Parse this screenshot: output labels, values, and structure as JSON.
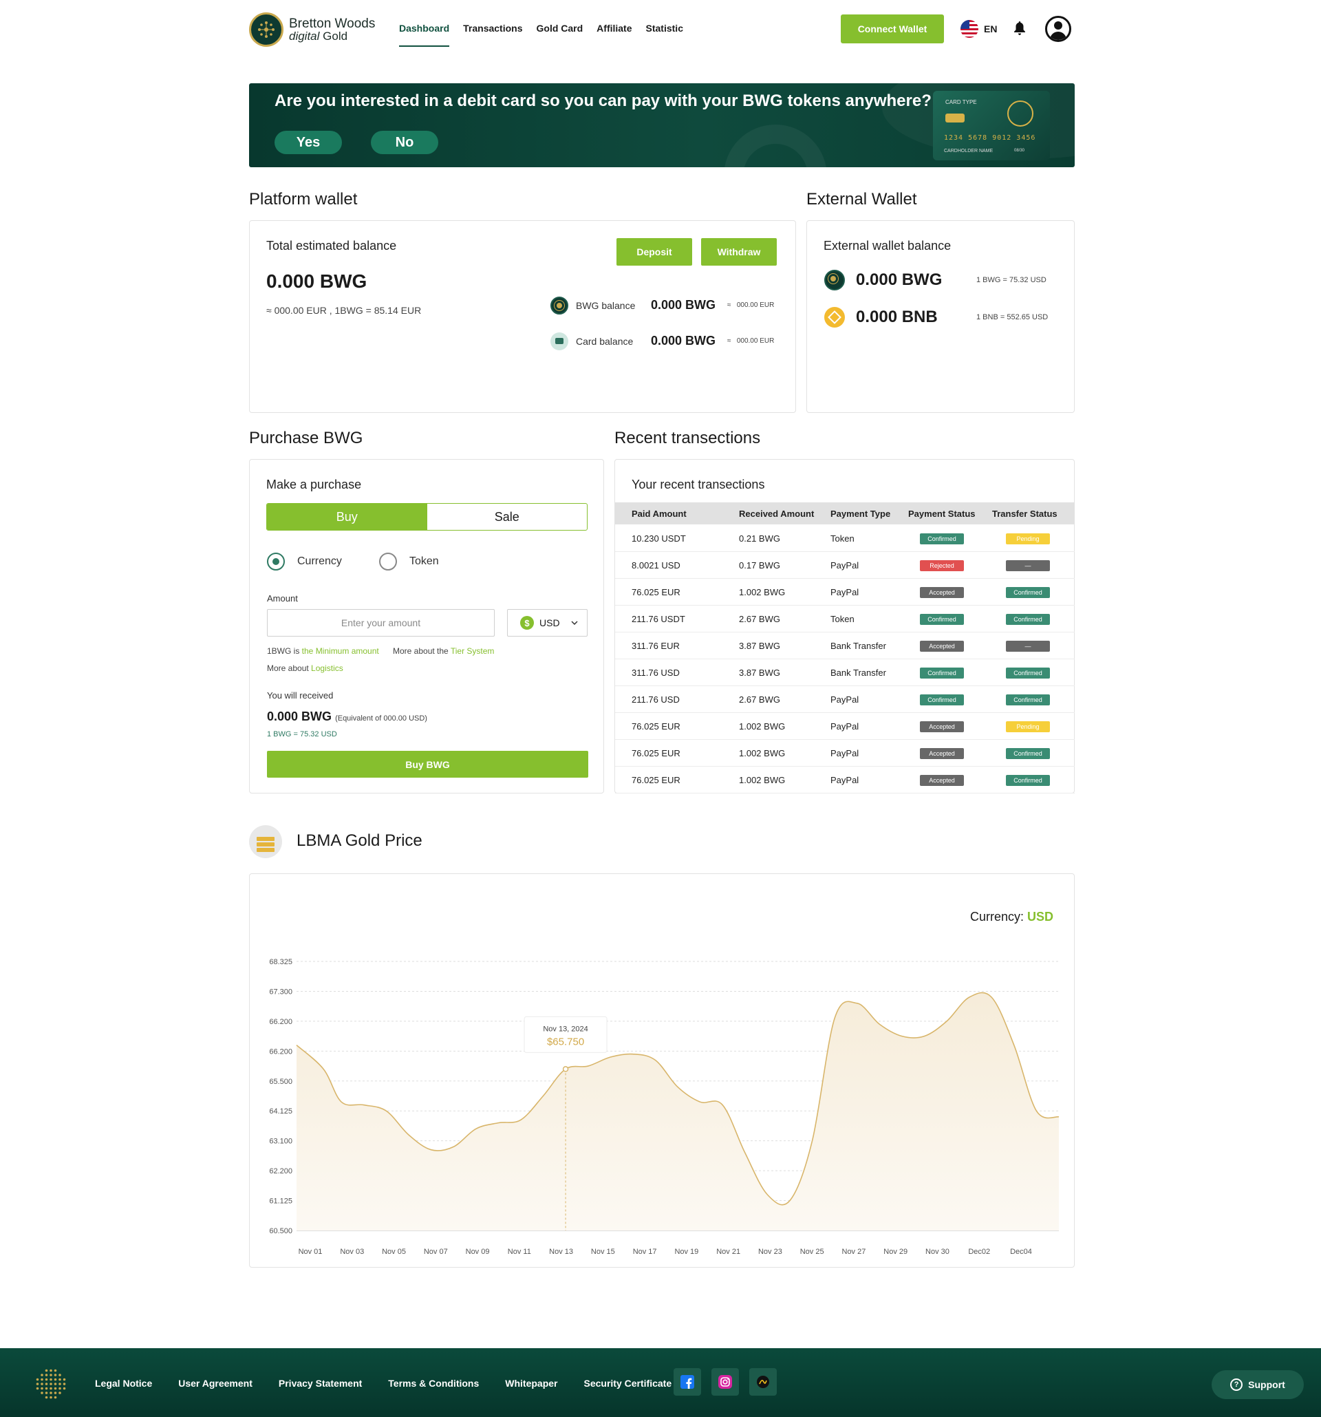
{
  "nav": {
    "logo_line1": "Bretton Woods",
    "logo_line2_italic": "digital",
    "logo_line2": "Gold",
    "menu": [
      "Dashboard",
      "Transactions",
      "Gold Card",
      "Affiliate",
      "Statistic"
    ],
    "active": "Dashboard",
    "connect_wallet": "Connect Wallet",
    "language": "EN"
  },
  "banner": {
    "question": "Are you interested in a debit card so you can pay with your BWG tokens anywhere?",
    "yes": "Yes",
    "no": "No",
    "card_type": "CARD TYPE",
    "card_number": "1234  5678  9012  3456",
    "card_holder": "CARDHOLDER NAME",
    "card_expiry": "08/30"
  },
  "platform_wallet": {
    "title": "Platform wallet",
    "label": "Total estimated balance",
    "deposit": "Deposit",
    "withdraw": "Withdraw",
    "total": "0.000 BWG",
    "approx": "000.00 EUR , 1BWG = 85.14 EUR",
    "bwg_label": "BWG balance",
    "bwg_value": "0.000 BWG",
    "bwg_eur": "000.00 EUR",
    "card_label": "Card balance",
    "card_value": "0.000 BWG",
    "card_eur": "000.00 EUR"
  },
  "external_wallet": {
    "title": "External Wallet",
    "label": "External wallet balance",
    "bwg_value": "0.000 BWG",
    "bwg_rate": "1 BWG  = 75.32 USD",
    "bnb_value": "0.000 BNB",
    "bnb_rate": "1 BNB  = 552.65 USD"
  },
  "purchase": {
    "title": "Purchase BWG",
    "label": "Make a purchase",
    "buy": "Buy",
    "sale": "Sale",
    "currency": "Currency",
    "token": "Token",
    "amount_label": "Amount",
    "amount_placeholder": "Enter your amount",
    "currency_select": "USD",
    "hint1_a": "1BWG is ",
    "hint1_b": "the Minimum amount",
    "hint2_a": "More about the ",
    "hint2_b": "Tier System",
    "hint3_a": "More about ",
    "hint3_b": "Logistics",
    "receive_label": "You will received",
    "receive_value": "0.000 BWG",
    "receive_equiv": "(Equivalent of 000.00 USD)",
    "rate": "1 BWG  =  75.32 USD",
    "buy_button": "Buy BWG"
  },
  "transactions": {
    "title": "Recent transections",
    "label": "Your recent transections",
    "headers": [
      "Paid Amount",
      "Received Amount",
      "Payment Type",
      "Payment Status",
      "Transfer Status"
    ],
    "rows": [
      {
        "paid": "10.230 USDT",
        "received": "0.21 BWG",
        "type": "Token",
        "payment": "Confirmed",
        "transfer": "Pending"
      },
      {
        "paid": "8.0021 USD",
        "received": "0.17 BWG",
        "type": "PayPal",
        "payment": "Rejected",
        "transfer": "—"
      },
      {
        "paid": "76.025 EUR",
        "received": "1.002 BWG",
        "type": "PayPal",
        "payment": "Accepted",
        "transfer": "Confirmed"
      },
      {
        "paid": "211.76 USDT",
        "received": "2.67 BWG",
        "type": "Token",
        "payment": "Confirmed",
        "transfer": "Confirmed"
      },
      {
        "paid": "311.76 EUR",
        "received": "3.87 BWG",
        "type": "Bank Transfer",
        "payment": "Accepted",
        "transfer": "—"
      },
      {
        "paid": "311.76 USD",
        "received": "3.87 BWG",
        "type": "Bank Transfer",
        "payment": "Confirmed",
        "transfer": "Confirmed"
      },
      {
        "paid": "211.76 USD",
        "received": "2.67 BWG",
        "type": "PayPal",
        "payment": "Confirmed",
        "transfer": "Confirmed"
      },
      {
        "paid": "76.025 EUR",
        "received": "1.002 BWG",
        "type": "PayPal",
        "payment": "Accepted",
        "transfer": "Pending"
      },
      {
        "paid": "76.025 EUR",
        "received": "1.002 BWG",
        "type": "PayPal",
        "payment": "Accepted",
        "transfer": "Confirmed"
      },
      {
        "paid": "76.025 EUR",
        "received": "1.002 BWG",
        "type": "PayPal",
        "payment": "Accepted",
        "transfer": "Confirmed"
      }
    ]
  },
  "gold": {
    "title": "LBMA Gold Price",
    "currency_label": "Currency: ",
    "currency_value": "USD",
    "tooltip_date": "Nov 13, 2024",
    "tooltip_value": "$65.750"
  },
  "colors": {
    "brand_green": "#86bf2e",
    "dark_green": "#0b4a3b",
    "gold_line": "#d8b56a",
    "gold_fill": "#f6ecd9"
  },
  "chart_data": {
    "type": "area",
    "title": "LBMA Gold Price",
    "y_tick_labels": [
      "60.500",
      "61.125",
      "62.200",
      "63.100",
      "64.125",
      "65.500",
      "66.200",
      "66.200",
      "67.300",
      "68.325"
    ],
    "x_tick_labels": [
      "Nov 01",
      "Nov 03",
      "Nov 05",
      "Nov 07",
      "Nov 09",
      "Nov 11",
      "Nov 13",
      "Nov 15",
      "Nov 17",
      "Nov 19",
      "Nov 21",
      "Nov 23",
      "Nov 25",
      "Nov 27",
      "Nov 29",
      "Nov 30",
      "Dec02",
      "Dec04"
    ],
    "y_tick_index_range": [
      0,
      9
    ],
    "x_tick_index_range": [
      0,
      17
    ],
    "series": [
      {
        "x": [
          0,
          0.6,
          1,
          1.5,
          2,
          2.5,
          3,
          3.5,
          4,
          4.5,
          5,
          5.5,
          6,
          6.5,
          7,
          7.5,
          8,
          8.5,
          9,
          9.5,
          10,
          10.5,
          11,
          11.5,
          12,
          12.5,
          13,
          13.5,
          14,
          14.5,
          15,
          15.5,
          16,
          16.5,
          17
        ],
        "y_tick_index": [
          6.2,
          5.4,
          4.3,
          4.2,
          4.0,
          3.2,
          2.7,
          2.8,
          3.4,
          3.6,
          3.7,
          4.5,
          5.4,
          5.5,
          5.8,
          5.9,
          5.7,
          4.8,
          4.3,
          4.2,
          2.6,
          1.2,
          1.0,
          3.0,
          7.1,
          7.6,
          6.9,
          6.5,
          6.5,
          7.0,
          7.8,
          7.8,
          6.2,
          4.0,
          3.8
        ]
      }
    ],
    "highlight": {
      "x": 6,
      "label": "Nov 13, 2024",
      "value": "$65.750"
    },
    "grid": true,
    "legend": "none"
  },
  "footer": {
    "links": [
      "Legal Notice",
      "User Agreement",
      "Privacy Statement",
      "Terms & Conditions",
      "Whitepaper",
      "Security Certificate"
    ],
    "support": "Support"
  }
}
